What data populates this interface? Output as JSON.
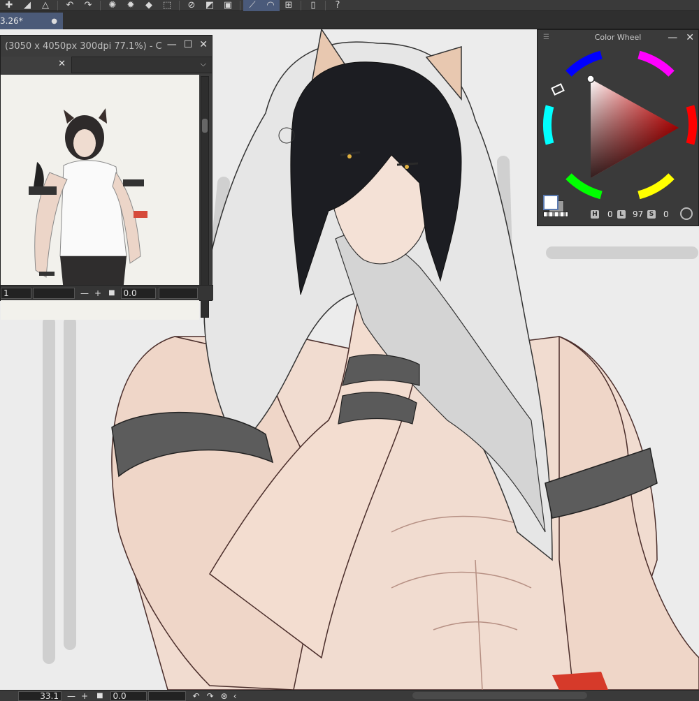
{
  "document": {
    "tab_title": "3.26*"
  },
  "toolbar": {
    "icons": [
      "new-layer-icon",
      "eraser-icon",
      "triangle-ruler-icon",
      "undo-icon",
      "redo-icon",
      "loading-icon",
      "burst-icon",
      "fill-icon",
      "transform-icon",
      "deselect-icon",
      "invert-icon",
      "frame-icon",
      "snap-ruler-icon",
      "snap-curve-icon",
      "ruler-edit-icon",
      "device-icon",
      "help-icon"
    ]
  },
  "subview": {
    "title": "(3050 x 4050px 300dpi 77.1%)  - C",
    "zoom_value": "1",
    "angle_value": "0.0"
  },
  "color_wheel": {
    "title": "Color Wheel",
    "hue_label": "H",
    "hue_value": "0",
    "lum_label": "L",
    "lum_value": "97",
    "sat_label": "S",
    "sat_value": "0",
    "main_color": "#ffffff",
    "sub_color": "#9a9a9a"
  },
  "statusbar": {
    "zoom_value": "33.1",
    "angle_value": "0.0"
  }
}
